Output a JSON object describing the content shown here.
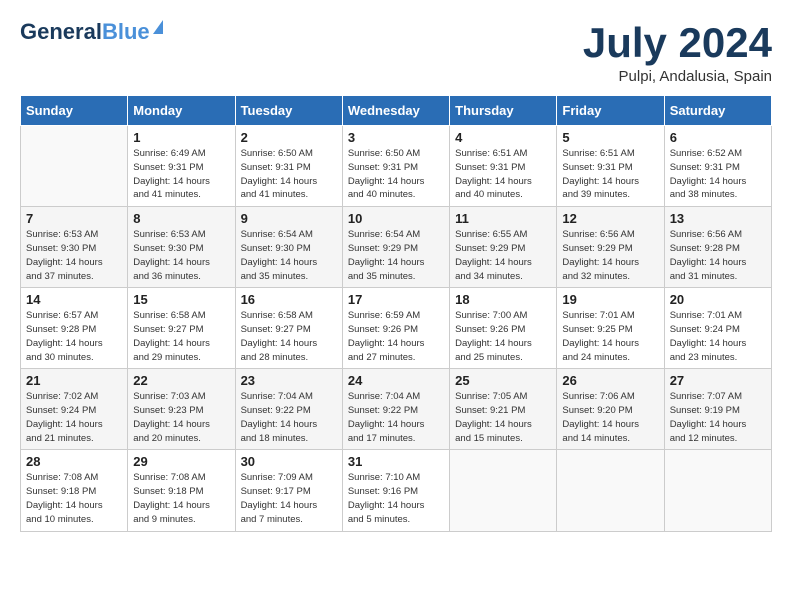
{
  "header": {
    "logo_line1": "General",
    "logo_line2": "Blue",
    "month_year": "July 2024",
    "location": "Pulpi, Andalusia, Spain"
  },
  "weekdays": [
    "Sunday",
    "Monday",
    "Tuesday",
    "Wednesday",
    "Thursday",
    "Friday",
    "Saturday"
  ],
  "weeks": [
    [
      {
        "day": "",
        "info": ""
      },
      {
        "day": "1",
        "info": "Sunrise: 6:49 AM\nSunset: 9:31 PM\nDaylight: 14 hours\nand 41 minutes."
      },
      {
        "day": "2",
        "info": "Sunrise: 6:50 AM\nSunset: 9:31 PM\nDaylight: 14 hours\nand 41 minutes."
      },
      {
        "day": "3",
        "info": "Sunrise: 6:50 AM\nSunset: 9:31 PM\nDaylight: 14 hours\nand 40 minutes."
      },
      {
        "day": "4",
        "info": "Sunrise: 6:51 AM\nSunset: 9:31 PM\nDaylight: 14 hours\nand 40 minutes."
      },
      {
        "day": "5",
        "info": "Sunrise: 6:51 AM\nSunset: 9:31 PM\nDaylight: 14 hours\nand 39 minutes."
      },
      {
        "day": "6",
        "info": "Sunrise: 6:52 AM\nSunset: 9:31 PM\nDaylight: 14 hours\nand 38 minutes."
      }
    ],
    [
      {
        "day": "7",
        "info": "Sunrise: 6:53 AM\nSunset: 9:30 PM\nDaylight: 14 hours\nand 37 minutes."
      },
      {
        "day": "8",
        "info": "Sunrise: 6:53 AM\nSunset: 9:30 PM\nDaylight: 14 hours\nand 36 minutes."
      },
      {
        "day": "9",
        "info": "Sunrise: 6:54 AM\nSunset: 9:30 PM\nDaylight: 14 hours\nand 35 minutes."
      },
      {
        "day": "10",
        "info": "Sunrise: 6:54 AM\nSunset: 9:29 PM\nDaylight: 14 hours\nand 35 minutes."
      },
      {
        "day": "11",
        "info": "Sunrise: 6:55 AM\nSunset: 9:29 PM\nDaylight: 14 hours\nand 34 minutes."
      },
      {
        "day": "12",
        "info": "Sunrise: 6:56 AM\nSunset: 9:29 PM\nDaylight: 14 hours\nand 32 minutes."
      },
      {
        "day": "13",
        "info": "Sunrise: 6:56 AM\nSunset: 9:28 PM\nDaylight: 14 hours\nand 31 minutes."
      }
    ],
    [
      {
        "day": "14",
        "info": "Sunrise: 6:57 AM\nSunset: 9:28 PM\nDaylight: 14 hours\nand 30 minutes."
      },
      {
        "day": "15",
        "info": "Sunrise: 6:58 AM\nSunset: 9:27 PM\nDaylight: 14 hours\nand 29 minutes."
      },
      {
        "day": "16",
        "info": "Sunrise: 6:58 AM\nSunset: 9:27 PM\nDaylight: 14 hours\nand 28 minutes."
      },
      {
        "day": "17",
        "info": "Sunrise: 6:59 AM\nSunset: 9:26 PM\nDaylight: 14 hours\nand 27 minutes."
      },
      {
        "day": "18",
        "info": "Sunrise: 7:00 AM\nSunset: 9:26 PM\nDaylight: 14 hours\nand 25 minutes."
      },
      {
        "day": "19",
        "info": "Sunrise: 7:01 AM\nSunset: 9:25 PM\nDaylight: 14 hours\nand 24 minutes."
      },
      {
        "day": "20",
        "info": "Sunrise: 7:01 AM\nSunset: 9:24 PM\nDaylight: 14 hours\nand 23 minutes."
      }
    ],
    [
      {
        "day": "21",
        "info": "Sunrise: 7:02 AM\nSunset: 9:24 PM\nDaylight: 14 hours\nand 21 minutes."
      },
      {
        "day": "22",
        "info": "Sunrise: 7:03 AM\nSunset: 9:23 PM\nDaylight: 14 hours\nand 20 minutes."
      },
      {
        "day": "23",
        "info": "Sunrise: 7:04 AM\nSunset: 9:22 PM\nDaylight: 14 hours\nand 18 minutes."
      },
      {
        "day": "24",
        "info": "Sunrise: 7:04 AM\nSunset: 9:22 PM\nDaylight: 14 hours\nand 17 minutes."
      },
      {
        "day": "25",
        "info": "Sunrise: 7:05 AM\nSunset: 9:21 PM\nDaylight: 14 hours\nand 15 minutes."
      },
      {
        "day": "26",
        "info": "Sunrise: 7:06 AM\nSunset: 9:20 PM\nDaylight: 14 hours\nand 14 minutes."
      },
      {
        "day": "27",
        "info": "Sunrise: 7:07 AM\nSunset: 9:19 PM\nDaylight: 14 hours\nand 12 minutes."
      }
    ],
    [
      {
        "day": "28",
        "info": "Sunrise: 7:08 AM\nSunset: 9:18 PM\nDaylight: 14 hours\nand 10 minutes."
      },
      {
        "day": "29",
        "info": "Sunrise: 7:08 AM\nSunset: 9:18 PM\nDaylight: 14 hours\nand 9 minutes."
      },
      {
        "day": "30",
        "info": "Sunrise: 7:09 AM\nSunset: 9:17 PM\nDaylight: 14 hours\nand 7 minutes."
      },
      {
        "day": "31",
        "info": "Sunrise: 7:10 AM\nSunset: 9:16 PM\nDaylight: 14 hours\nand 5 minutes."
      },
      {
        "day": "",
        "info": ""
      },
      {
        "day": "",
        "info": ""
      },
      {
        "day": "",
        "info": ""
      }
    ]
  ]
}
